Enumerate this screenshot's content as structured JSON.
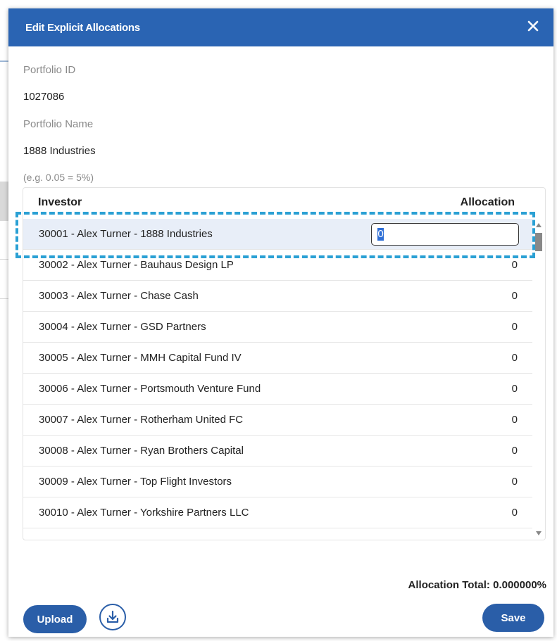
{
  "modal": {
    "title": "Edit Explicit Allocations",
    "close_icon": "close-icon"
  },
  "portfolio": {
    "id_label": "Portfolio ID",
    "id_value": "1027086",
    "name_label": "Portfolio Name",
    "name_value": "1888 Industries",
    "hint": "(e.g. 0.05 = 5%)"
  },
  "grid": {
    "headers": {
      "investor": "Investor",
      "allocation": "Allocation"
    },
    "rows": [
      {
        "investor": "30001 - Alex Turner - 1888 Industries",
        "allocation": "0"
      },
      {
        "investor": "30002 - Alex Turner - Bauhaus Design LP",
        "allocation": "0"
      },
      {
        "investor": "30003 - Alex Turner - Chase Cash",
        "allocation": "0"
      },
      {
        "investor": "30004 - Alex Turner - GSD Partners",
        "allocation": "0"
      },
      {
        "investor": "30005 - Alex Turner - MMH Capital Fund IV",
        "allocation": "0"
      },
      {
        "investor": "30006 - Alex Turner - Portsmouth Venture Fund",
        "allocation": "0"
      },
      {
        "investor": "30007 - Alex Turner - Rotherham United FC",
        "allocation": "0"
      },
      {
        "investor": "30008 - Alex Turner - Ryan Brothers Capital",
        "allocation": "0"
      },
      {
        "investor": "30009 - Alex Turner - Top Flight Investors",
        "allocation": "0"
      },
      {
        "investor": "30010 - Alex Turner - Yorkshire Partners LLC",
        "allocation": "0"
      }
    ],
    "selected_row": 0
  },
  "footer": {
    "total_label": "Allocation Total: 0.000000%",
    "upload_label": "Upload",
    "save_label": "Save",
    "download_icon": "download-icon"
  },
  "colors": {
    "header": "#2a64b3",
    "button": "#2a5ea8",
    "highlight": "#2aa0d4"
  }
}
